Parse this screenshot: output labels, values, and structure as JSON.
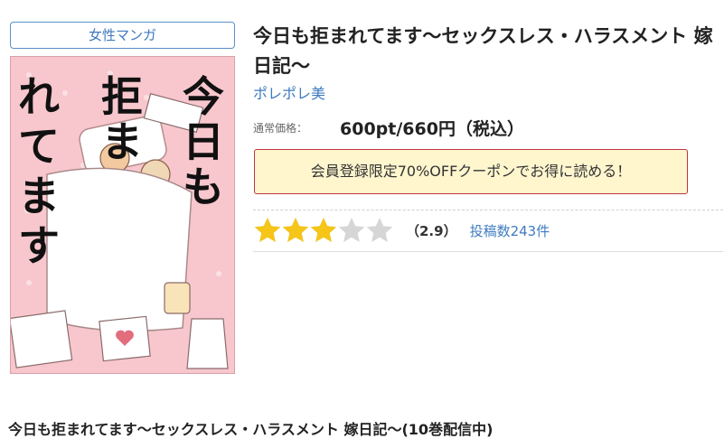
{
  "category": {
    "label": "女性マンガ"
  },
  "cover": {
    "title_lines": [
      "今",
      "日",
      "も",
      "拒",
      "ま",
      "れ",
      "て",
      "ま",
      "す"
    ],
    "subtitle": "セックスレス・ハラスメント 嫁日記〜",
    "author": "ポレポレ美",
    "background_color": "#f7c7cd"
  },
  "book": {
    "title": "今日も拒まれてます〜セックスレス・ハラスメント 嫁日記〜",
    "author": "ポレポレ美"
  },
  "price": {
    "label": "通常価格：",
    "value": "600pt/660円（税込）"
  },
  "coupon": {
    "text": "会員登録限定70%OFFクーポンでお得に読める！"
  },
  "rating": {
    "value": 2.9,
    "max": 5,
    "score_text": "（2.9）",
    "review_text": "投稿数243件",
    "star_icon": "star-icon",
    "star_color": "#f5c518",
    "empty_color": "#d6d6d6"
  },
  "series": {
    "title": "今日も拒まれてます〜セックスレス・ハラスメント 嫁日記〜(10巻配信中)"
  }
}
